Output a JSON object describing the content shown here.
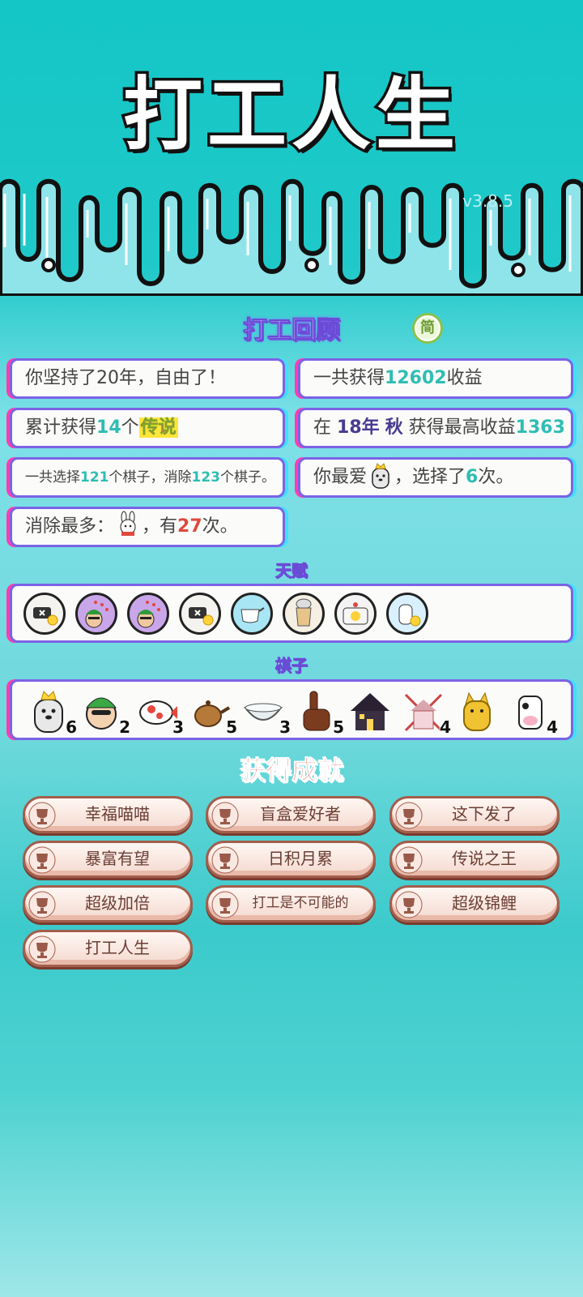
{
  "header": {
    "title": "打工人生",
    "version": "v3.8.5"
  },
  "review": {
    "title": "打工回顾",
    "simp_toggle": "简"
  },
  "stats": {
    "years_prefix": "你坚持了",
    "years_value": "20",
    "years_suffix": "年，自由了！",
    "total_prefix": "一共获得",
    "total_value": "12602",
    "total_suffix": "收益",
    "legend_prefix": "累计获得",
    "legend_value": "14",
    "legend_unit": "个",
    "legend_word": "传说",
    "best_prefix": "在",
    "best_year": "18年",
    "best_season": "秋",
    "best_mid": "获得最高收益",
    "best_value": "1363",
    "choose_prefix": "一共选择",
    "choose_value": "121",
    "choose_mid": "个棋子，消除",
    "remove_value": "123",
    "choose_suffix": "个棋子。",
    "fav_prefix": "你最爱",
    "fav_mid": "，选择了",
    "fav_value": "6",
    "fav_suffix": "次。",
    "most_prefix": "消除最多：",
    "most_mid": "，有",
    "most_value": "27",
    "most_suffix": "次。"
  },
  "talents": {
    "title": "天赋",
    "icons": [
      "no-ad-ticket-icon",
      "worker-face-icon",
      "worker-face-icon",
      "no-ad-ticket-icon",
      "milk-jug-icon",
      "bubble-tea-icon",
      "duck-pot-icon",
      "cat-coin-icon"
    ]
  },
  "pieces": {
    "title": "棋子",
    "items": [
      {
        "icon": "crowned-husky-icon",
        "count": "6"
      },
      {
        "icon": "green-hat-man-icon",
        "count": "2"
      },
      {
        "icon": "koi-fish-icon",
        "count": "3"
      },
      {
        "icon": "teapot-icon",
        "count": "5"
      },
      {
        "icon": "bowl-icon",
        "count": "3"
      },
      {
        "icon": "pointing-hand-icon",
        "count": "5"
      },
      {
        "icon": "house-icon",
        "count": ""
      },
      {
        "icon": "shrine-icon",
        "count": "4"
      },
      {
        "icon": "yellow-cat-icon",
        "count": ""
      },
      {
        "icon": "cow-icon",
        "count": "4"
      }
    ]
  },
  "achievements": {
    "title": "获得成就",
    "items": [
      "幸福喵喵",
      "盲盒爱好者",
      "这下发了",
      "暴富有望",
      "日积月累",
      "传说之王",
      "超级加倍",
      "打工是不可能的",
      "超级锦鲤",
      "打工人生"
    ]
  },
  "colors": {
    "bg_top": "#14c6c6",
    "card_border": "#7b63e6",
    "accent_teal": "#2fbdb3",
    "accent_red": "#e0483d"
  }
}
